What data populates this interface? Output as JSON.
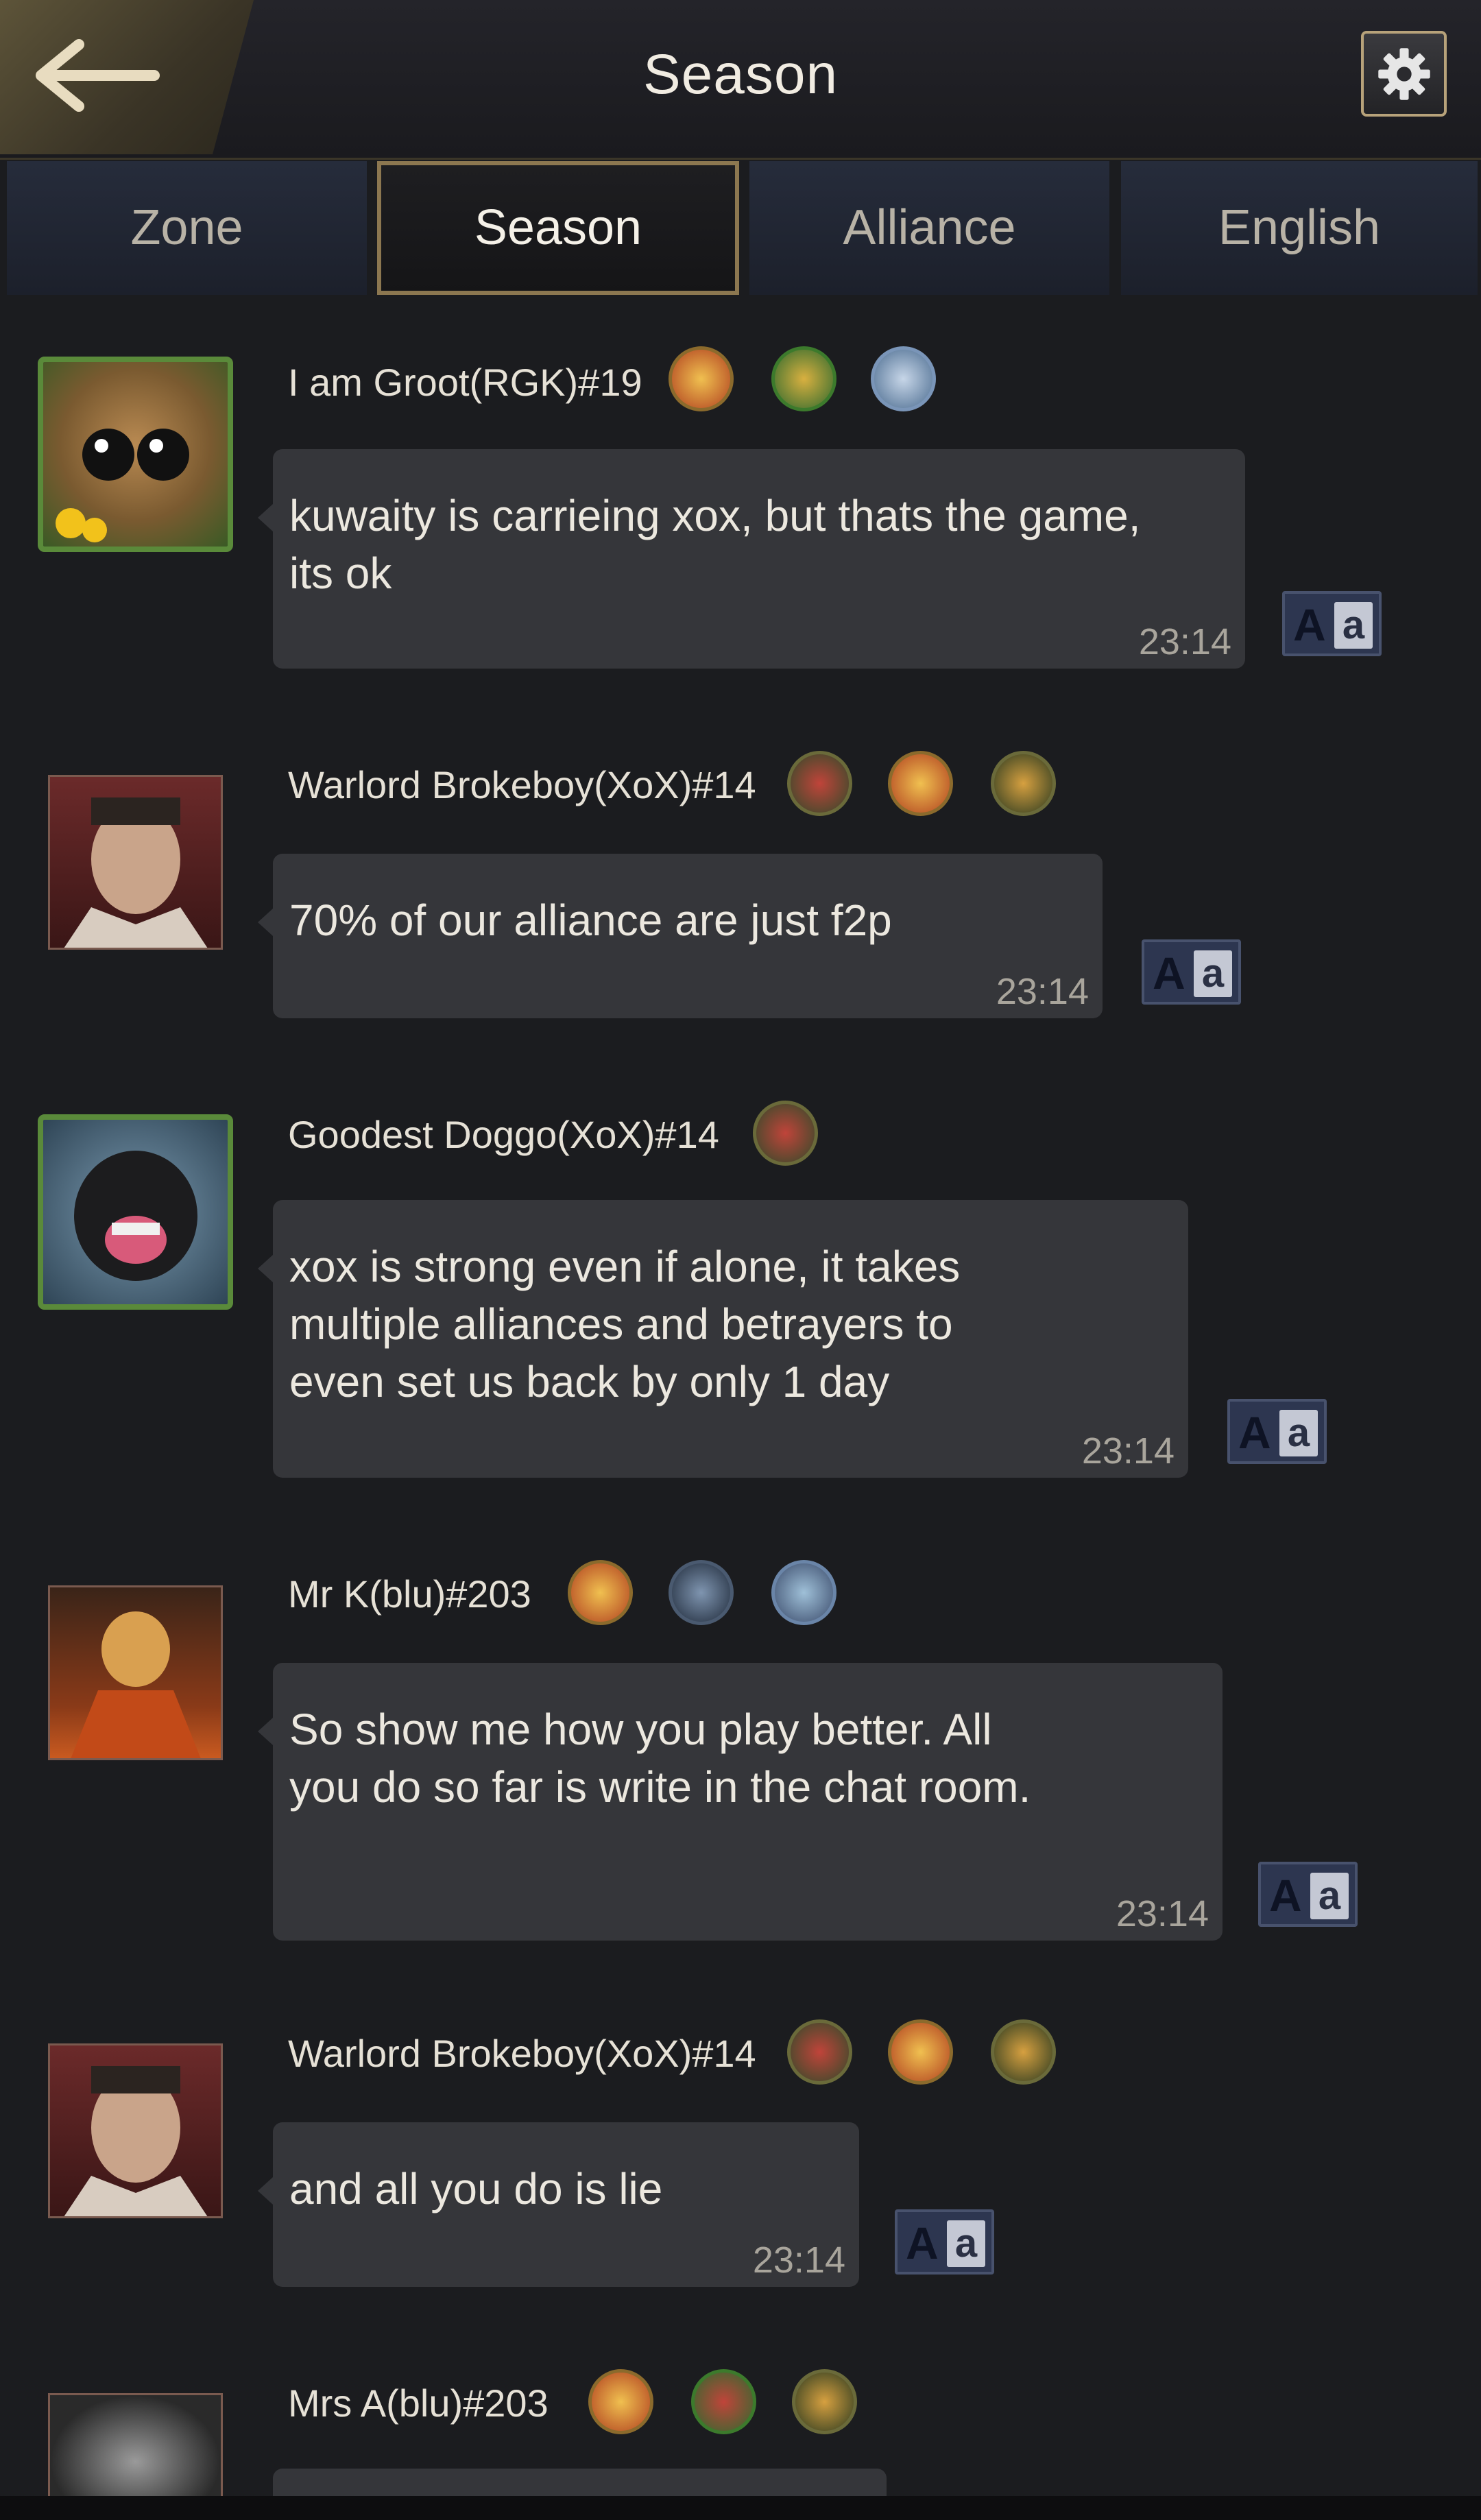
{
  "header": {
    "title": "Season",
    "back_icon": "arrow-left-icon",
    "settings_icon": "gear-icon"
  },
  "tabs": [
    {
      "label": "Zone",
      "active": false
    },
    {
      "label": "Season",
      "active": true
    },
    {
      "label": "Alliance",
      "active": false
    },
    {
      "label": "English",
      "active": false
    }
  ],
  "messages": [
    {
      "sender": "I am Groot(RGK)#19",
      "text": "kuwaity is carrieing xox, but thats the game, its ok",
      "time": "23:14"
    },
    {
      "sender": "Warlord Brokeboy(XoX)#14",
      "text": "70% of our alliance are just f2p",
      "time": "23:14"
    },
    {
      "sender": "Goodest Doggo(XoX)#14",
      "text": "xox is strong even if alone, it takes multiple alliances and betrayers to even set us back by only 1 day",
      "time": "23:14"
    },
    {
      "sender": "Mr K(blu)#203",
      "text": "So show me how you play better. All you do so far is write in the chat room.",
      "time": "23:14"
    },
    {
      "sender": "Warlord Brokeboy(XoX)#14",
      "text": "and all you do is lie",
      "time": "23:14"
    },
    {
      "sender": "Mrs A(blu)#203"
    }
  ],
  "translate_button": {
    "label_upper": "A",
    "label_lower": "a"
  },
  "colors": {
    "bubble": "#35363a",
    "tab_active_border": "#8c7750",
    "translate_bg": "#2d3650"
  }
}
